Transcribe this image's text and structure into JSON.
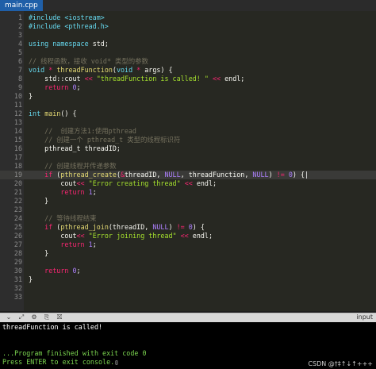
{
  "tab": {
    "filename": "main.cpp"
  },
  "colors": {
    "default": "#f8f8f2",
    "keyword": "#f92672",
    "type": "#66d9ef",
    "function": "#e6db74",
    "string": "#a6e22e",
    "comment": "#75715e",
    "number": "#ae81ff",
    "active_tab": "#1f5fa8"
  },
  "editor": {
    "lines": [
      {
        "n": "1",
        "tokens": [
          [
            "#include ",
            "type"
          ],
          [
            "<iostream>",
            "type"
          ]
        ]
      },
      {
        "n": "2",
        "tokens": [
          [
            "#include ",
            "type"
          ],
          [
            "<pthread.h>",
            "type"
          ]
        ]
      },
      {
        "n": "3",
        "tokens": []
      },
      {
        "n": "4",
        "tokens": [
          [
            "using",
            "type"
          ],
          [
            " ",
            "default"
          ],
          [
            "namespace",
            "type"
          ],
          [
            " std;",
            "default"
          ]
        ]
      },
      {
        "n": "5",
        "tokens": []
      },
      {
        "n": "6",
        "tokens": [
          [
            "// 线程函数，接收 void* 类型的参数",
            "comment"
          ]
        ]
      },
      {
        "n": "7",
        "tokens": [
          [
            "void",
            "type"
          ],
          [
            " ",
            "default"
          ],
          [
            "*",
            "keyword"
          ],
          [
            " ",
            "default"
          ],
          [
            "threadFunction",
            "function"
          ],
          [
            "(",
            "default"
          ],
          [
            "void",
            "type"
          ],
          [
            " ",
            "default"
          ],
          [
            "*",
            "keyword"
          ],
          [
            " args) {",
            "default"
          ]
        ]
      },
      {
        "n": "8",
        "tokens": [
          [
            "    std::cout ",
            "default"
          ],
          [
            "<<",
            "keyword"
          ],
          [
            " ",
            "default"
          ],
          [
            "\"threadFunction is called! \"",
            "string"
          ],
          [
            " ",
            "default"
          ],
          [
            "<<",
            "keyword"
          ],
          [
            " endl;",
            "default"
          ]
        ]
      },
      {
        "n": "9",
        "tokens": [
          [
            "    ",
            "default"
          ],
          [
            "return",
            "keyword"
          ],
          [
            " ",
            "default"
          ],
          [
            "0",
            "number"
          ],
          [
            ";",
            "default"
          ]
        ]
      },
      {
        "n": "10",
        "tokens": [
          [
            "}",
            "default"
          ]
        ]
      },
      {
        "n": "11",
        "tokens": []
      },
      {
        "n": "12",
        "tokens": [
          [
            "int",
            "type"
          ],
          [
            " ",
            "default"
          ],
          [
            "main",
            "function"
          ],
          [
            "() {",
            "default"
          ]
        ]
      },
      {
        "n": "13",
        "tokens": []
      },
      {
        "n": "14",
        "tokens": [
          [
            "    //  创建方法1:使用pthread",
            "comment"
          ]
        ]
      },
      {
        "n": "15",
        "tokens": [
          [
            "    // 创建一个 pthread_t 类型的线程标识符",
            "comment"
          ]
        ]
      },
      {
        "n": "16",
        "tokens": [
          [
            "    pthread_t threadID;",
            "default"
          ]
        ]
      },
      {
        "n": "17",
        "tokens": []
      },
      {
        "n": "18",
        "tokens": [
          [
            "    // 创建线程并传递参数",
            "comment"
          ]
        ]
      },
      {
        "n": "19",
        "active": true,
        "tokens": [
          [
            "    ",
            "default"
          ],
          [
            "if",
            "keyword"
          ],
          [
            " (",
            "default"
          ],
          [
            "pthread_create",
            "function"
          ],
          [
            "(",
            "default"
          ],
          [
            "&",
            "keyword"
          ],
          [
            "threadID, ",
            "default"
          ],
          [
            "NULL",
            "number"
          ],
          [
            ", threadFunction, ",
            "default"
          ],
          [
            "NULL",
            "number"
          ],
          [
            ") ",
            "default"
          ],
          [
            "!=",
            "keyword"
          ],
          [
            " ",
            "default"
          ],
          [
            "0",
            "number"
          ],
          [
            ") {",
            "default"
          ]
        ]
      },
      {
        "n": "20",
        "tokens": [
          [
            "        cout",
            "default"
          ],
          [
            "<<",
            "keyword"
          ],
          [
            " ",
            "default"
          ],
          [
            "\"Error creating thread\"",
            "string"
          ],
          [
            " ",
            "default"
          ],
          [
            "<<",
            "keyword"
          ],
          [
            " endl;",
            "default"
          ]
        ]
      },
      {
        "n": "21",
        "tokens": [
          [
            "        ",
            "default"
          ],
          [
            "return",
            "keyword"
          ],
          [
            " ",
            "default"
          ],
          [
            "1",
            "number"
          ],
          [
            ";",
            "default"
          ]
        ]
      },
      {
        "n": "22",
        "tokens": [
          [
            "    }",
            "default"
          ]
        ]
      },
      {
        "n": "23",
        "tokens": []
      },
      {
        "n": "24",
        "tokens": [
          [
            "    // 等待线程结束",
            "comment"
          ]
        ]
      },
      {
        "n": "25",
        "tokens": [
          [
            "    ",
            "default"
          ],
          [
            "if",
            "keyword"
          ],
          [
            " (",
            "default"
          ],
          [
            "pthread_join",
            "function"
          ],
          [
            "(threadID, ",
            "default"
          ],
          [
            "NULL",
            "number"
          ],
          [
            ") ",
            "default"
          ],
          [
            "!=",
            "keyword"
          ],
          [
            " ",
            "default"
          ],
          [
            "0",
            "number"
          ],
          [
            ") {",
            "default"
          ]
        ]
      },
      {
        "n": "26",
        "tokens": [
          [
            "        cout",
            "default"
          ],
          [
            "<<",
            "keyword"
          ],
          [
            " ",
            "default"
          ],
          [
            "\"Error joining thread\"",
            "string"
          ],
          [
            " ",
            "default"
          ],
          [
            "<<",
            "keyword"
          ],
          [
            " endl;",
            "default"
          ]
        ]
      },
      {
        "n": "27",
        "tokens": [
          [
            "        ",
            "default"
          ],
          [
            "return",
            "keyword"
          ],
          [
            " ",
            "default"
          ],
          [
            "1",
            "number"
          ],
          [
            ";",
            "default"
          ]
        ]
      },
      {
        "n": "28",
        "tokens": [
          [
            "    }",
            "default"
          ]
        ]
      },
      {
        "n": "29",
        "tokens": []
      },
      {
        "n": "30",
        "tokens": [
          [
            "    ",
            "default"
          ],
          [
            "return",
            "keyword"
          ],
          [
            " ",
            "default"
          ],
          [
            "0",
            "number"
          ],
          [
            ";",
            "default"
          ]
        ]
      },
      {
        "n": "31",
        "tokens": [
          [
            "}",
            "default"
          ]
        ]
      },
      {
        "n": "32",
        "tokens": []
      },
      {
        "n": "33",
        "tokens": []
      }
    ]
  },
  "panel": {
    "buttons": [
      {
        "name": "expand-panel-icon",
        "glyph": "⌄"
      },
      {
        "name": "resize-panel-icon",
        "glyph": "⤢"
      },
      {
        "name": "settings-icon",
        "glyph": "⚙"
      },
      {
        "name": "copy-output-icon",
        "glyph": "⎘"
      },
      {
        "name": "clear-output-icon",
        "glyph": "⛝"
      }
    ],
    "label": "input"
  },
  "console": {
    "lines": [
      {
        "text": "threadFunction is called!",
        "color": "#ffffff"
      },
      {
        "text": "",
        "color": "#ffffff"
      },
      {
        "text": "",
        "color": "#ffffff"
      },
      {
        "text": "...Program finished with exit code 0",
        "color": "#7cd650"
      },
      {
        "text": "Press ENTER to exit console.",
        "color": "#7cd650"
      }
    ],
    "watermark": "CSDN @†‡↑↓↑+++"
  }
}
